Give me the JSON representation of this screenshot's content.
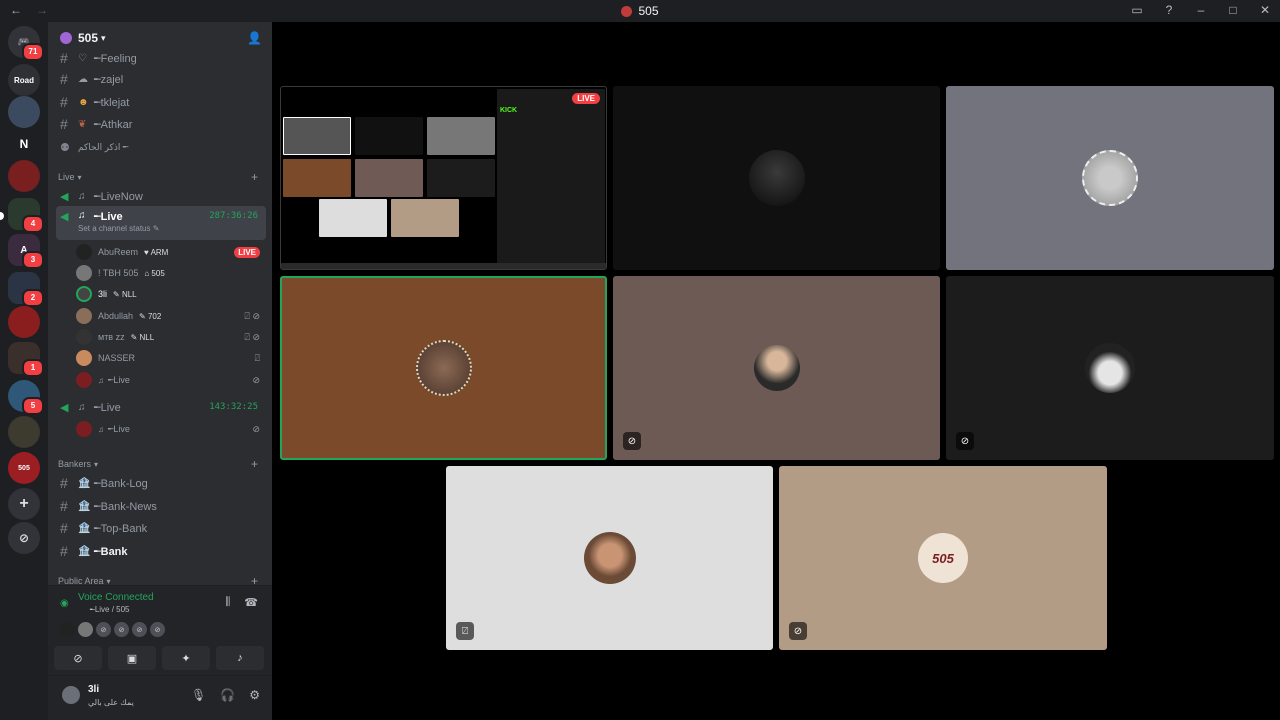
{
  "window": {
    "title": "505"
  },
  "servers": [
    {
      "label": "",
      "badge": "71"
    },
    {
      "label": "Road",
      "badge": ""
    },
    {
      "label": "",
      "badge": ""
    },
    {
      "label": "N",
      "badge": ""
    },
    {
      "label": "",
      "badge": ""
    },
    {
      "label": "",
      "badge": "4"
    },
    {
      "label": "A",
      "badge": "3"
    },
    {
      "label": "",
      "badge": "2"
    },
    {
      "label": "",
      "badge": ""
    },
    {
      "label": "",
      "badge": "1"
    },
    {
      "label": "",
      "badge": "5"
    },
    {
      "label": "",
      "badge": ""
    },
    {
      "label": "505",
      "badge": ""
    }
  ],
  "server": {
    "name": "505",
    "chevron": "v"
  },
  "channels_top": [
    {
      "emoji": "♡",
      "name": "╾Feeling"
    },
    {
      "emoji": "☁",
      "name": "╾zajel"
    },
    {
      "emoji": "☻",
      "name": "╾tklejat"
    },
    {
      "emoji": "❦",
      "name": "╾Athkar"
    },
    {
      "emoji": "⚉",
      "name": "اذكر الحاكم ╾"
    }
  ],
  "categories": {
    "live": "Live",
    "bankers": "Bankers",
    "public": "Public Area"
  },
  "live_channels": [
    {
      "name": "╾LiveNow",
      "timer": ""
    },
    {
      "name": "╾Live",
      "timer": "287:36:26",
      "status": "Set a channel status ✎"
    },
    {
      "name": "╾Live",
      "timer": "143:32:25"
    }
  ],
  "voice_users_1": [
    {
      "name": "AbuReem",
      "tag": "♥ ARM",
      "live": "LIVE"
    },
    {
      "name": "! TBH 505",
      "tag": "⌂ 505",
      "live": ""
    },
    {
      "name": "3li",
      "tag": "✎ NLL",
      "live": ""
    },
    {
      "name": "Abdullah",
      "tag": "✎ 702",
      "live": ""
    },
    {
      "name": "ᴍᴛʙ zz",
      "tag": "✎ NLL",
      "live": ""
    },
    {
      "name": "NASSER",
      "tag": "",
      "live": ""
    },
    {
      "name": "╾Live",
      "tag": "",
      "live": ""
    }
  ],
  "voice_users_2": [
    {
      "name": "╾Live",
      "tag": "",
      "live": ""
    }
  ],
  "bank_channels": [
    {
      "name": "╾Bank-Log"
    },
    {
      "name": "╾Bank-News"
    },
    {
      "name": "╾Top-Bank"
    },
    {
      "name": "╾Bank"
    }
  ],
  "voice_panel": {
    "status": "Voice Connected",
    "sub": "╾Live / 505"
  },
  "user": {
    "name": "3li",
    "status": "يمك على بالي"
  },
  "stage": {
    "live_label": "LIVE",
    "stream_brand": "KICK",
    "tile_logo": "505"
  }
}
